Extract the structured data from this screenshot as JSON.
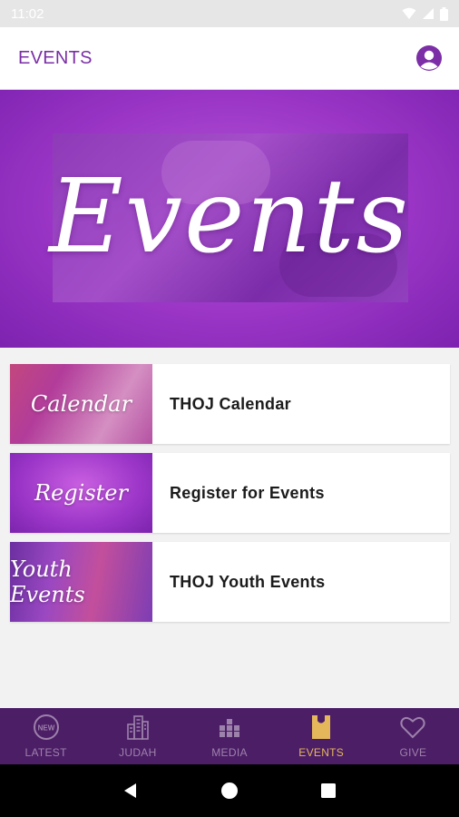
{
  "status_bar": {
    "time": "11:02"
  },
  "app_bar": {
    "title": "EVENTS"
  },
  "hero": {
    "title": "Events"
  },
  "events_list": [
    {
      "thumb_text": "Calendar",
      "label": "THOJ Calendar"
    },
    {
      "thumb_text": "Register",
      "label": "Register for Events"
    },
    {
      "thumb_text": "Youth Events",
      "label": "THOJ Youth Events"
    }
  ],
  "bottom_nav": [
    {
      "label": "LATEST",
      "icon": "new-badge-icon",
      "active": false
    },
    {
      "label": "JUDAH",
      "icon": "buildings-icon",
      "active": false
    },
    {
      "label": "MEDIA",
      "icon": "media-blocks-icon",
      "active": false
    },
    {
      "label": "EVENTS",
      "icon": "ticket-icon",
      "active": true
    },
    {
      "label": "GIVE",
      "icon": "heart-icon",
      "active": false
    }
  ],
  "colors": {
    "accent": "#7b2ea6",
    "nav_bg": "#4c1e66",
    "nav_active": "#e4b85a",
    "nav_inactive": "#9d82ab"
  },
  "new_badge_text": "NEW"
}
